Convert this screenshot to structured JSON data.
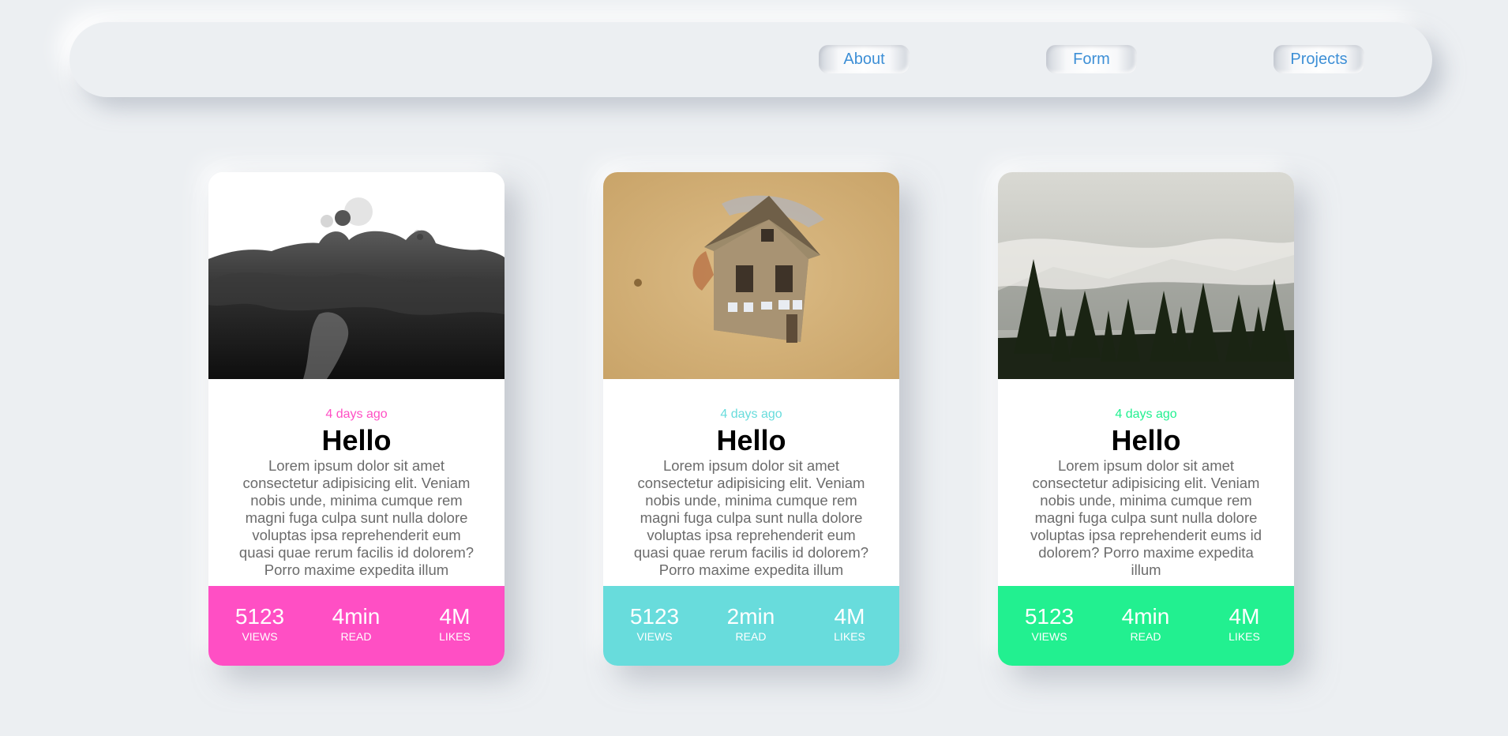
{
  "nav": {
    "about": "About",
    "form": "Form",
    "projects": "Projects",
    "link_color": "#3d8fd6"
  },
  "cards": [
    {
      "image": "ink-splash-image",
      "accent": "#ff4fc4",
      "date": "4 days ago",
      "title": "Hello",
      "text": "Lorem ipsum dolor sit amet consectetur adipisicing elit. Veniam nobis unde, minima cumque rem magni fuga culpa sunt nulla dolore voluptas ipsa reprehenderit eum quasi quae rerum facilis id dolorem? Porro maxime expedita illum",
      "stats": [
        {
          "value": "5123",
          "label": "VIEWS"
        },
        {
          "value": "4min",
          "label": "READ"
        },
        {
          "value": "4M",
          "label": "LIKES"
        }
      ]
    },
    {
      "image": "painted-house-image",
      "accent": "#68dcdc",
      "date": "4 days ago",
      "title": "Hello",
      "text": "Lorem ipsum dolor sit amet consectetur adipisicing elit. Veniam nobis unde, minima cumque rem magni fuga culpa sunt nulla dolore voluptas ipsa reprehenderit eum quasi quae rerum facilis id dolorem? Porro maxime expedita illum",
      "stats": [
        {
          "value": "5123",
          "label": "VIEWS"
        },
        {
          "value": "2min",
          "label": "READ"
        },
        {
          "value": "4M",
          "label": "LIKES"
        }
      ]
    },
    {
      "image": "misty-forest-image",
      "accent": "#22f090",
      "date": "4 days ago",
      "title": "Hello",
      "text": "Lorem ipsum dolor sit amet consectetur adipisicing elit. Veniam nobis unde, minima cumque rem magni fuga culpa sunt nulla dolore voluptas ipsa reprehenderit eums id dolorem? Porro maxime expedita illum",
      "stats": [
        {
          "value": "5123",
          "label": "VIEWS"
        },
        {
          "value": "4min",
          "label": "READ"
        },
        {
          "value": "4M",
          "label": "LIKES"
        }
      ]
    }
  ]
}
